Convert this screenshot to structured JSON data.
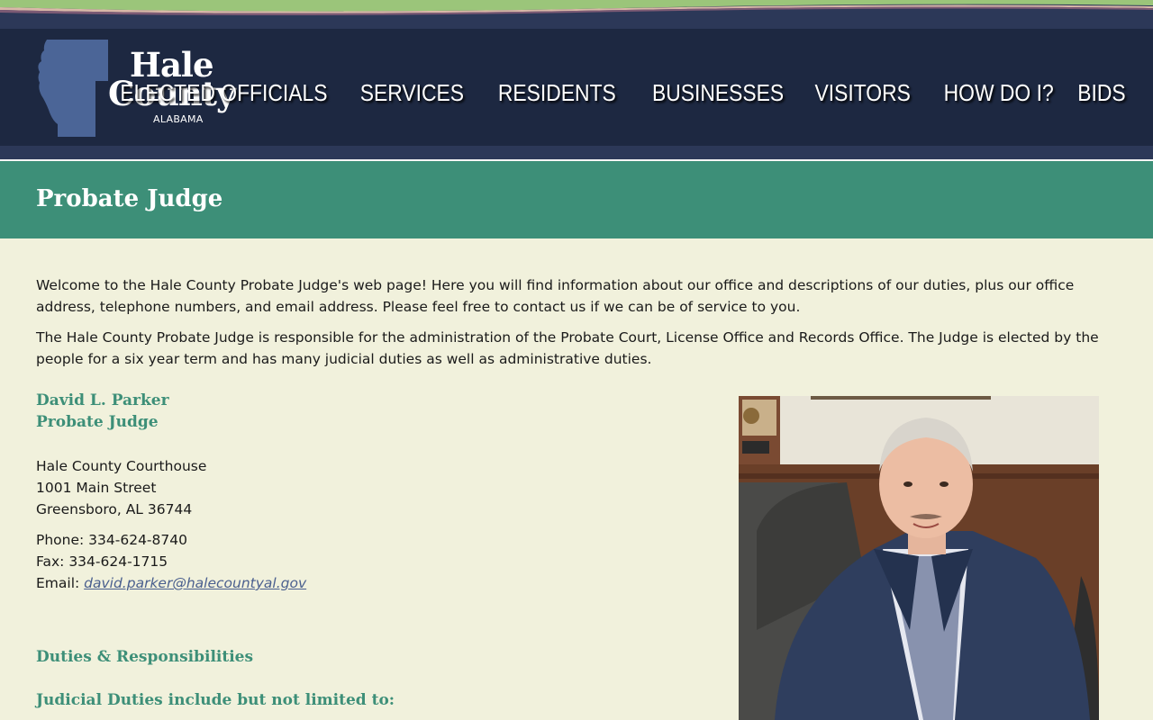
{
  "site": {
    "logo": {
      "line1": "Hale",
      "line2": "County",
      "state": "ALABAMA"
    },
    "nav": [
      "ELECTED OFFICIALS",
      "SERVICES",
      "RESIDENTS",
      "BUSINESSES",
      "VISITORS",
      "HOW DO I?",
      "BIDS"
    ]
  },
  "page": {
    "title": "Probate Judge",
    "intro": [
      "Welcome to the Hale County Probate Judge's web page! Here you will find information about our office and descriptions of our duties, plus our office address, telephone numbers, and email address.  Please feel free to contact us if we can be of service to you.",
      "The Hale County Probate Judge is responsible for the administration of the Probate Court, License Office and Records Office. The Judge is elected by the people for a six year term and has many judicial duties as well as administrative duties."
    ],
    "official": {
      "name": "David L. Parker",
      "role": "Probate Judge"
    },
    "address": [
      "Hale County Courthouse",
      "1001 Main Street",
      "Greensboro, AL 36744"
    ],
    "phone": "Phone: 334-624-8740",
    "fax": "Fax: 334-624-1715",
    "email_label": "Email: ",
    "email": "david.parker@halecountyal.gov",
    "duties_heading": "Duties & Responsibilities",
    "judicial_heading": "Judicial Duties include but not limited to:"
  },
  "colors": {
    "header": "#1d2841",
    "title_bar": "#3d8f78",
    "background": "#f1f1dc",
    "accent_green": "#3d8f78",
    "link": "#4a5f8e"
  }
}
